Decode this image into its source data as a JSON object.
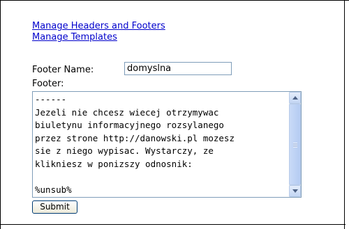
{
  "links": {
    "manage_headers_footers": "Manage Headers and Footers",
    "manage_templates": "Manage Templates"
  },
  "form": {
    "footer_name_label": "Footer Name:",
    "footer_name_value": "domyslna",
    "footer_label": "Footer:",
    "footer_lines": [
      "------",
      "Jezeli nie chcesz wiecej otrzymywac",
      "biuletynu informacyjnego rozsylanego",
      "przez strone http://danowski.pl mozesz",
      "sie z niego wypisac. Wystarczy, ze",
      "klikniesz w ponizszy odnosnik:",
      "",
      "%unsub%"
    ],
    "submit_label": "Submit"
  },
  "colors": {
    "link": "#0000cc",
    "input_border": "#7f9db9",
    "button_border": "#003c74"
  },
  "icons": {
    "scroll_up": "chevron-up-icon",
    "scroll_down": "chevron-down-icon"
  }
}
